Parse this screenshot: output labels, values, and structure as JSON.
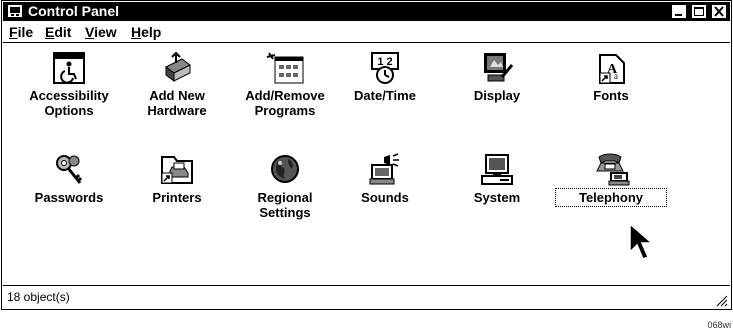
{
  "window": {
    "title": "Control Panel",
    "status": "18 object(s)"
  },
  "menu": [
    {
      "pre": "",
      "key": "F",
      "post": "ile"
    },
    {
      "pre": "",
      "key": "E",
      "post": "dit"
    },
    {
      "pre": "",
      "key": "V",
      "post": "iew"
    },
    {
      "pre": "",
      "key": "H",
      "post": "elp"
    }
  ],
  "items": [
    {
      "line1": "Accessibility",
      "line2": "Options",
      "icon": "accessibility-icon"
    },
    {
      "line1": "Add New",
      "line2": "Hardware",
      "icon": "hardware-icon"
    },
    {
      "line1": "Add/Remove",
      "line2": "Programs",
      "icon": "programs-icon"
    },
    {
      "line1": "Date/Time",
      "line2": "",
      "icon": "clock-icon"
    },
    {
      "line1": "Display",
      "line2": "",
      "icon": "display-icon"
    },
    {
      "line1": "Fonts",
      "line2": "",
      "icon": "fonts-icon"
    },
    {
      "line1": "Passwords",
      "line2": "",
      "icon": "keys-icon"
    },
    {
      "line1": "Printers",
      "line2": "",
      "icon": "printer-icon"
    },
    {
      "line1": "Regional",
      "line2": "Settings",
      "icon": "globe-icon"
    },
    {
      "line1": "Sounds",
      "line2": "",
      "icon": "speaker-icon"
    },
    {
      "line1": "System",
      "line2": "",
      "icon": "computer-icon"
    },
    {
      "line1": "Telephony",
      "line2": "",
      "icon": "telephone-icon"
    }
  ],
  "figure_code": "068wi"
}
